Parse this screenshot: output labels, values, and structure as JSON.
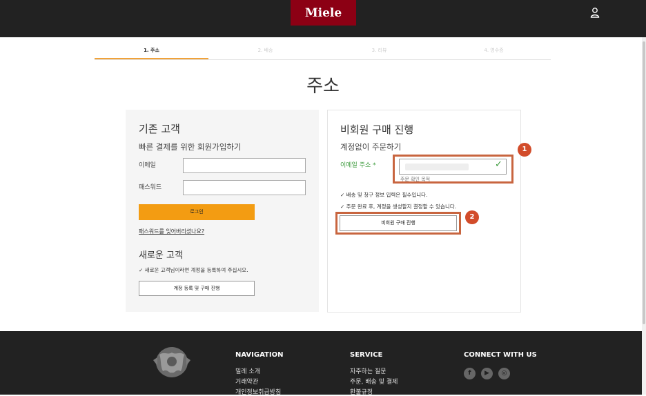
{
  "header": {
    "logo": "Miele",
    "user_icon": "user-icon"
  },
  "steps": [
    {
      "label": "1. 주소",
      "active": true
    },
    {
      "label": "2. 배송",
      "active": false
    },
    {
      "label": "3. 리뷰",
      "active": false
    },
    {
      "label": "4. 영수증",
      "active": false
    }
  ],
  "page_title": "주소",
  "existing": {
    "title": "기존 고객",
    "subtitle": "빠른 결제를 위한 회원가입하기",
    "email_label": "이메일",
    "password_label": "패스워드",
    "email_value": "",
    "password_value": "",
    "login_button": "로그인",
    "forgot_link": "패스워드를 잊어버리셨나요?"
  },
  "new_customer": {
    "title": "새로운 고객",
    "note": "✓ 새로운 고객님이라면 계정을 등록하여 주십시오.",
    "register_button": "계정 등록 및 구매 진행"
  },
  "guest": {
    "title": "비회원 구매 진행",
    "subtitle": "계정없이 주문하기",
    "email_label": "이메일 주소 *",
    "email_hint": "주문 확인 목적",
    "note1": "✓ 배송 및 청구 정보 입력은 필수입니다.",
    "note2": "✓ 주문 완료 후, 계정을 생성할지 결정할 수 있습니다.",
    "button": "비회원 구매 진행",
    "check": "✓"
  },
  "annotations": {
    "badge1": "1",
    "badge2": "2",
    "highlight_color": "#c8653f",
    "badge_color": "#d24c2a"
  },
  "colors": {
    "brand": "#8c0014",
    "accent": "#f39c12",
    "success": "#3a9a3a"
  },
  "footer": {
    "navigation": {
      "title": "NAVIGATION",
      "links": [
        "밀레 소개",
        "거래약관",
        "개인정보취급방침"
      ]
    },
    "service": {
      "title": "SERVICE",
      "links": [
        "자주하는 질문",
        "주문, 배송 및 결제",
        "환불규정"
      ]
    },
    "connect": {
      "title": "CONNECT WITH US",
      "icons": [
        "facebook-icon",
        "youtube-icon",
        "instagram-icon"
      ]
    }
  }
}
